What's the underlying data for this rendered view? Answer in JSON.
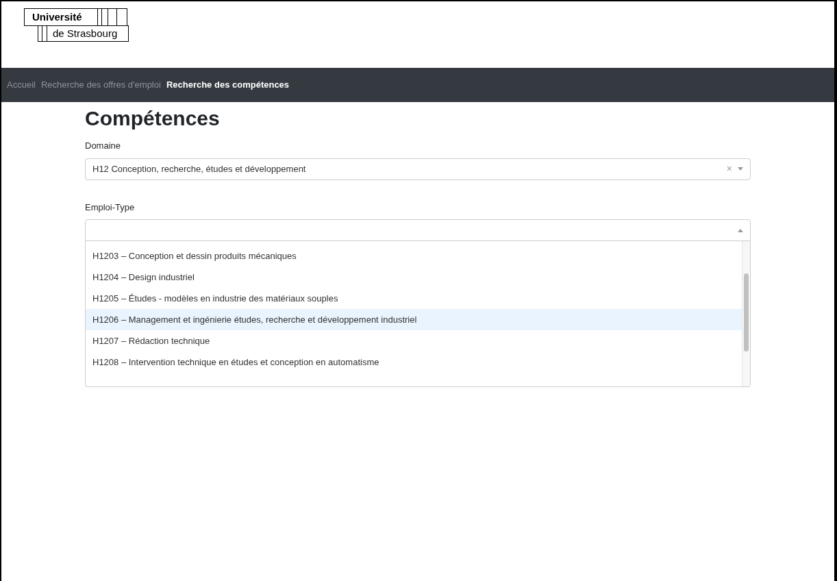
{
  "logo": {
    "line_1": "Université",
    "line_2": "de Strasbourg"
  },
  "nav": [
    {
      "label": "Accueil",
      "selected": false
    },
    {
      "label": "Recherche des offres d'emploi",
      "selected": false
    },
    {
      "label": "Recherche des compétences",
      "selected": true
    }
  ],
  "heading": "Compétences",
  "domaine": {
    "label": "Domaine",
    "value": "H12 Conception, recherche, études et développement",
    "clear": "×"
  },
  "emploi_type": {
    "label": "Emploi-Type",
    "expanded": true,
    "options": [
      {
        "label": "H1203 – Conception et dessin produits mécaniques",
        "selected": false
      },
      {
        "label": "H1204 – Design industriel",
        "selected": false
      },
      {
        "label": "H1205 – Études - modèles en industrie des matériaux souples",
        "selected": false
      },
      {
        "label": "H1206 – Management et ingénierie études, recherche et développement industriel",
        "selected": true
      },
      {
        "label": "H1207 – Rédaction technique",
        "selected": false
      },
      {
        "label": "H1208 – Intervention technique en études et conception en automatisme",
        "selected": false
      }
    ]
  }
}
